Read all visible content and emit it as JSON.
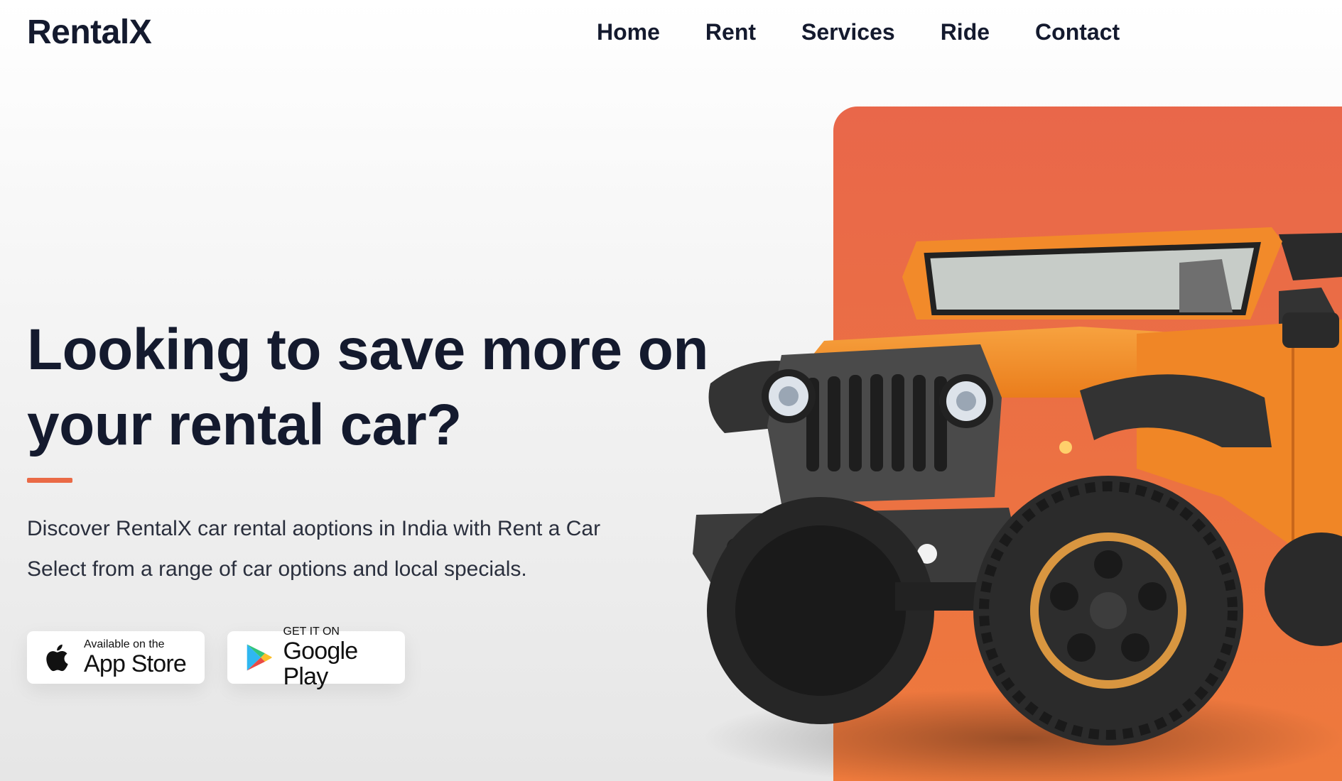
{
  "brand": {
    "name": "RentalX"
  },
  "nav": {
    "items": [
      {
        "label": "Home"
      },
      {
        "label": "Rent"
      },
      {
        "label": "Services"
      },
      {
        "label": "Ride"
      },
      {
        "label": "Contact"
      }
    ]
  },
  "hero": {
    "title": "Looking to save more on your rental car?",
    "description_line1": "Discover RentalX car rental aoptions in India with Rent a Car",
    "description_line2": "Select from a range of car options and local specials.",
    "accent_color": "#ea6a46",
    "panel_color": "#e9674a",
    "car_color": "#f28a2a"
  },
  "stores": {
    "apple": {
      "small": "Available on the",
      "big": "App Store",
      "icon": "apple-icon"
    },
    "google": {
      "small": "GET IT ON",
      "big": "Google Play",
      "icon": "google-play-icon"
    }
  }
}
